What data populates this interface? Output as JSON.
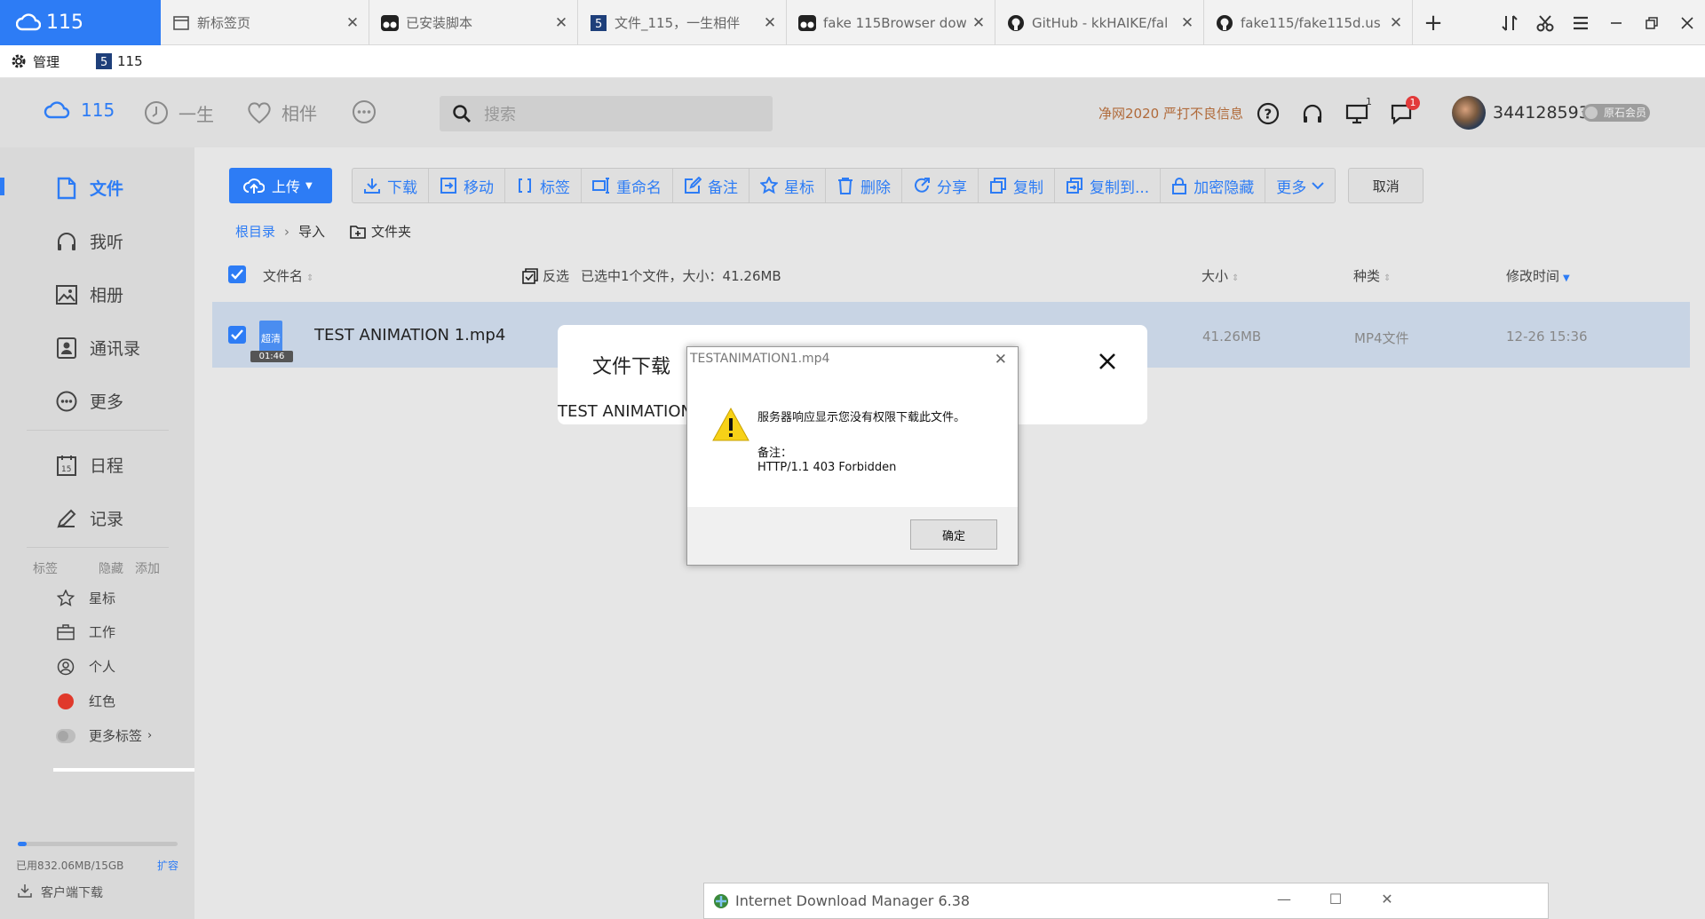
{
  "browser": {
    "tabs": [
      {
        "label": "115",
        "active": true,
        "icon": "cloud-icon"
      },
      {
        "label": "新标签页",
        "icon": "newtab-icon"
      },
      {
        "label": "已安装脚本",
        "icon": "tampermonkey-icon"
      },
      {
        "label": "文件_115，一生相伴",
        "icon": "site-115-icon"
      },
      {
        "label": "fake 115Browser dow",
        "icon": "tampermonkey-icon"
      },
      {
        "label": "GitHub - kkHAIKE/fal",
        "icon": "github-icon"
      },
      {
        "label": "fake115/fake115d.us",
        "icon": "github-icon"
      }
    ],
    "close_glyph": "✕",
    "new_tab_glyph": "+",
    "actions": [
      "sync-icon",
      "cut-icon",
      "menu-icon",
      "minimize-icon",
      "restore-icon",
      "close-icon"
    ]
  },
  "bookmarks": [
    {
      "label": "管理",
      "icon": "gear-icon"
    },
    {
      "label": "115",
      "icon": "site-115-icon"
    }
  ],
  "header": {
    "logo_text": "115",
    "nav": [
      {
        "label": "一生",
        "icon": "clock-icon"
      },
      {
        "label": "相伴",
        "icon": "heart-icon"
      }
    ],
    "search_placeholder": "搜索",
    "notice": "净网2020 严打不良信息",
    "monitor_superscript": "1",
    "message_badge": "1",
    "user_id": "344128593",
    "membership": "原石会员"
  },
  "sidebar": {
    "items": [
      {
        "label": "文件",
        "icon": "file-icon",
        "active": true
      },
      {
        "label": "我听",
        "icon": "headphones-icon"
      },
      {
        "label": "相册",
        "icon": "image-icon"
      },
      {
        "label": "通讯录",
        "icon": "contacts-icon"
      },
      {
        "label": "更多",
        "icon": "more-icon"
      },
      {
        "label": "日程",
        "icon": "calendar-icon"
      },
      {
        "label": "记录",
        "icon": "pen-icon"
      }
    ],
    "tags_header": {
      "label": "标签",
      "hide": "隐藏",
      "add": "添加"
    },
    "tags": [
      {
        "label": "星标",
        "icon": "star-icon"
      },
      {
        "label": "工作",
        "icon": "briefcase-icon"
      },
      {
        "label": "个人",
        "icon": "person-icon"
      },
      {
        "label": "红色",
        "icon": "red-dot-icon",
        "color": "#e0392b"
      },
      {
        "label": "更多标签",
        "icon": "gray-toggle-icon"
      }
    ],
    "storage": {
      "text": "已用832.06MB/15GB",
      "used_fraction": 0.054
    },
    "expand_label": "扩容",
    "client_download": "客户端下载"
  },
  "toolbar": {
    "upload": "上传",
    "buttons": [
      {
        "label": "下载",
        "icon": "download-icon"
      },
      {
        "label": "移动",
        "icon": "move-icon"
      },
      {
        "label": "标签",
        "icon": "brackets-icon"
      },
      {
        "label": "重命名",
        "icon": "rename-icon"
      },
      {
        "label": "备注",
        "icon": "edit-icon"
      },
      {
        "label": "星标",
        "icon": "star-icon"
      },
      {
        "label": "删除",
        "icon": "trash-icon"
      },
      {
        "label": "分享",
        "icon": "share-icon"
      },
      {
        "label": "复制",
        "icon": "copy-icon"
      },
      {
        "label": "复制到...",
        "icon": "copy-to-icon"
      },
      {
        "label": "加密隐藏",
        "icon": "lock-icon"
      },
      {
        "label": "更多",
        "icon": "chevron-down-icon"
      }
    ],
    "cancel": "取消"
  },
  "breadcrumb": {
    "root": "根目录",
    "current": "导入",
    "folder": "文件夹"
  },
  "list_header": {
    "name": "文件名",
    "invert": "反选",
    "selection": "已选中1个文件，大小：41.26MB",
    "size": "大小",
    "kind": "种类",
    "modified": "修改时间"
  },
  "files": [
    {
      "name": "TEST ANIMATION 1.mp4",
      "quality": "超清",
      "duration": "01:46",
      "size": "41.26MB",
      "kind": "MP4文件",
      "modified": "12-26 15:36"
    }
  ],
  "download_modal": {
    "title": "文件下载",
    "filename": "TEST ANIMATION"
  },
  "error_dialog": {
    "title": "TESTANIMATION1.mp4",
    "message": "服务器响应显示您没有权限下载此文件。",
    "note_label": "备注：",
    "note": "HTTP/1.1 403 Forbidden",
    "ok": "确定"
  },
  "idm_window": {
    "title": "Internet Download Manager 6.38"
  },
  "colors": {
    "accent": "#2d7cf5",
    "badge": "#e23a3a",
    "red_tag": "#e0392b"
  }
}
